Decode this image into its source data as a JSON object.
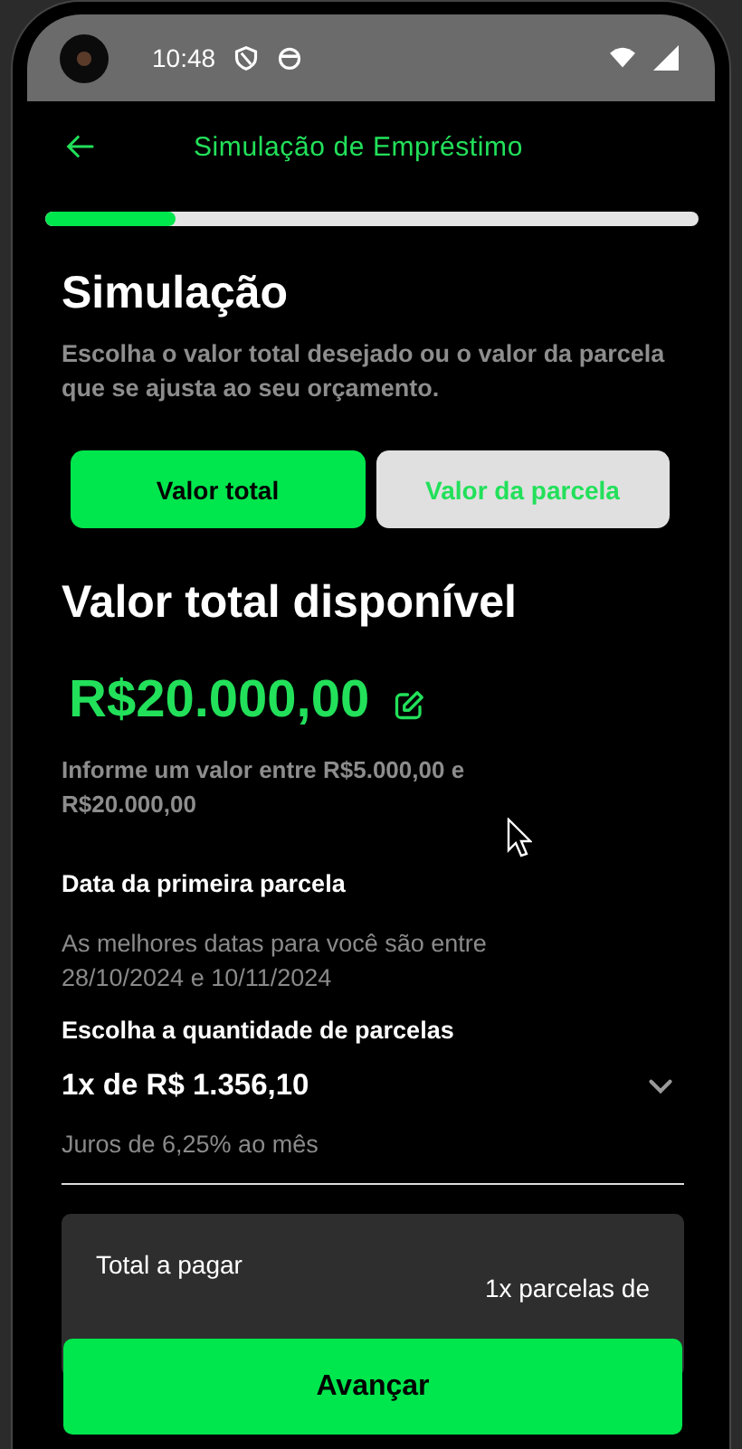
{
  "status_bar": {
    "time": "10:48"
  },
  "header": {
    "title": "Simulação de Empréstimo"
  },
  "progress": {
    "level": 0.2
  },
  "intro": {
    "title": "Simulação",
    "description": "Escolha o valor total desejado ou o valor da parcela que se ajusta ao seu orçamento."
  },
  "tabs": [
    {
      "label": "Valor total",
      "selected": true
    },
    {
      "label": "Valor da parcela",
      "selected": false
    }
  ],
  "amount": {
    "title": "Valor total disponível",
    "value": "R$20.000,00",
    "hint": "Informe um valor entre R$5.000,00 e R$20.000,00"
  },
  "first_installment": {
    "label": "Data da primeira parcela",
    "note": "As melhores datas para você são entre 28/10/2024 e 10/11/2024"
  },
  "installments": {
    "label": "Escolha a quantidade de parcelas",
    "value": "1x de R$ 1.356,10",
    "interest": "Juros de 6,25% ao mês"
  },
  "summary": {
    "total_label": "Total a pagar",
    "installments_label": "1x parcelas de"
  },
  "buttons": [
    "Avançar"
  ]
}
